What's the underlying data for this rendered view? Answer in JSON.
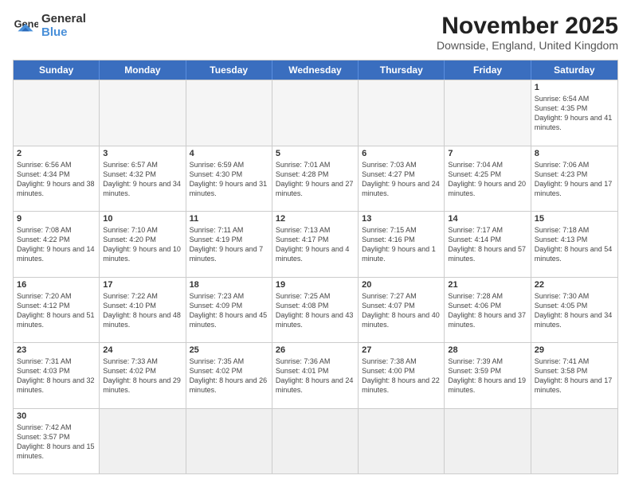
{
  "logo": {
    "text_general": "General",
    "text_blue": "Blue"
  },
  "title": {
    "month_year": "November 2025",
    "location": "Downside, England, United Kingdom"
  },
  "header_days": [
    "Sunday",
    "Monday",
    "Tuesday",
    "Wednesday",
    "Thursday",
    "Friday",
    "Saturday"
  ],
  "weeks": [
    [
      {
        "day": "",
        "info": ""
      },
      {
        "day": "",
        "info": ""
      },
      {
        "day": "",
        "info": ""
      },
      {
        "day": "",
        "info": ""
      },
      {
        "day": "",
        "info": ""
      },
      {
        "day": "",
        "info": ""
      },
      {
        "day": "1",
        "info": "Sunrise: 6:54 AM\nSunset: 4:35 PM\nDaylight: 9 hours and 41 minutes."
      }
    ],
    [
      {
        "day": "2",
        "info": "Sunrise: 6:56 AM\nSunset: 4:34 PM\nDaylight: 9 hours and 38 minutes."
      },
      {
        "day": "3",
        "info": "Sunrise: 6:57 AM\nSunset: 4:32 PM\nDaylight: 9 hours and 34 minutes."
      },
      {
        "day": "4",
        "info": "Sunrise: 6:59 AM\nSunset: 4:30 PM\nDaylight: 9 hours and 31 minutes."
      },
      {
        "day": "5",
        "info": "Sunrise: 7:01 AM\nSunset: 4:28 PM\nDaylight: 9 hours and 27 minutes."
      },
      {
        "day": "6",
        "info": "Sunrise: 7:03 AM\nSunset: 4:27 PM\nDaylight: 9 hours and 24 minutes."
      },
      {
        "day": "7",
        "info": "Sunrise: 7:04 AM\nSunset: 4:25 PM\nDaylight: 9 hours and 20 minutes."
      },
      {
        "day": "8",
        "info": "Sunrise: 7:06 AM\nSunset: 4:23 PM\nDaylight: 9 hours and 17 minutes."
      }
    ],
    [
      {
        "day": "9",
        "info": "Sunrise: 7:08 AM\nSunset: 4:22 PM\nDaylight: 9 hours and 14 minutes."
      },
      {
        "day": "10",
        "info": "Sunrise: 7:10 AM\nSunset: 4:20 PM\nDaylight: 9 hours and 10 minutes."
      },
      {
        "day": "11",
        "info": "Sunrise: 7:11 AM\nSunset: 4:19 PM\nDaylight: 9 hours and 7 minutes."
      },
      {
        "day": "12",
        "info": "Sunrise: 7:13 AM\nSunset: 4:17 PM\nDaylight: 9 hours and 4 minutes."
      },
      {
        "day": "13",
        "info": "Sunrise: 7:15 AM\nSunset: 4:16 PM\nDaylight: 9 hours and 1 minute."
      },
      {
        "day": "14",
        "info": "Sunrise: 7:17 AM\nSunset: 4:14 PM\nDaylight: 8 hours and 57 minutes."
      },
      {
        "day": "15",
        "info": "Sunrise: 7:18 AM\nSunset: 4:13 PM\nDaylight: 8 hours and 54 minutes."
      }
    ],
    [
      {
        "day": "16",
        "info": "Sunrise: 7:20 AM\nSunset: 4:12 PM\nDaylight: 8 hours and 51 minutes."
      },
      {
        "day": "17",
        "info": "Sunrise: 7:22 AM\nSunset: 4:10 PM\nDaylight: 8 hours and 48 minutes."
      },
      {
        "day": "18",
        "info": "Sunrise: 7:23 AM\nSunset: 4:09 PM\nDaylight: 8 hours and 45 minutes."
      },
      {
        "day": "19",
        "info": "Sunrise: 7:25 AM\nSunset: 4:08 PM\nDaylight: 8 hours and 43 minutes."
      },
      {
        "day": "20",
        "info": "Sunrise: 7:27 AM\nSunset: 4:07 PM\nDaylight: 8 hours and 40 minutes."
      },
      {
        "day": "21",
        "info": "Sunrise: 7:28 AM\nSunset: 4:06 PM\nDaylight: 8 hours and 37 minutes."
      },
      {
        "day": "22",
        "info": "Sunrise: 7:30 AM\nSunset: 4:05 PM\nDaylight: 8 hours and 34 minutes."
      }
    ],
    [
      {
        "day": "23",
        "info": "Sunrise: 7:31 AM\nSunset: 4:03 PM\nDaylight: 8 hours and 32 minutes."
      },
      {
        "day": "24",
        "info": "Sunrise: 7:33 AM\nSunset: 4:02 PM\nDaylight: 8 hours and 29 minutes."
      },
      {
        "day": "25",
        "info": "Sunrise: 7:35 AM\nSunset: 4:02 PM\nDaylight: 8 hours and 26 minutes."
      },
      {
        "day": "26",
        "info": "Sunrise: 7:36 AM\nSunset: 4:01 PM\nDaylight: 8 hours and 24 minutes."
      },
      {
        "day": "27",
        "info": "Sunrise: 7:38 AM\nSunset: 4:00 PM\nDaylight: 8 hours and 22 minutes."
      },
      {
        "day": "28",
        "info": "Sunrise: 7:39 AM\nSunset: 3:59 PM\nDaylight: 8 hours and 19 minutes."
      },
      {
        "day": "29",
        "info": "Sunrise: 7:41 AM\nSunset: 3:58 PM\nDaylight: 8 hours and 17 minutes."
      }
    ],
    [
      {
        "day": "30",
        "info": "Sunrise: 7:42 AM\nSunset: 3:57 PM\nDaylight: 8 hours and 15 minutes."
      },
      {
        "day": "",
        "info": ""
      },
      {
        "day": "",
        "info": ""
      },
      {
        "day": "",
        "info": ""
      },
      {
        "day": "",
        "info": ""
      },
      {
        "day": "",
        "info": ""
      },
      {
        "day": "",
        "info": ""
      }
    ]
  ]
}
